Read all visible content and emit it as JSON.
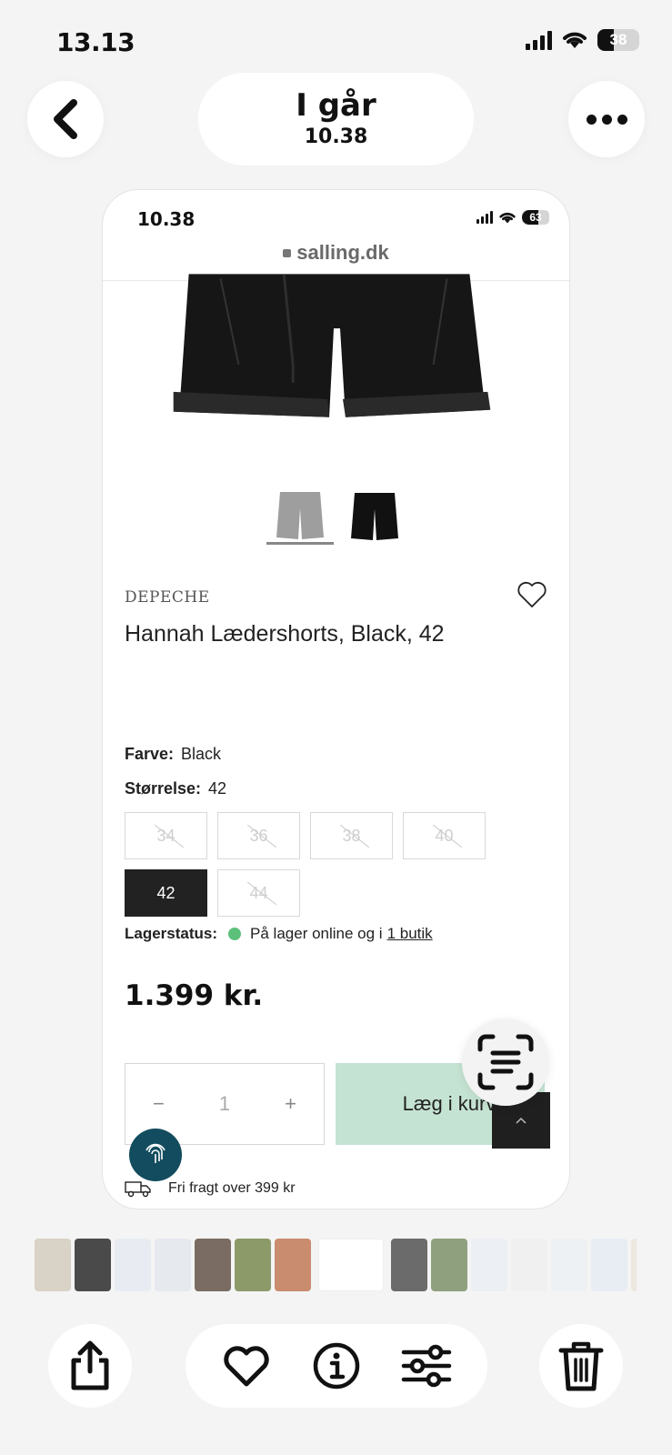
{
  "os_status": {
    "time": "13.13",
    "battery": "38"
  },
  "header": {
    "title": "I går",
    "subtitle": "10.38"
  },
  "screenshot": {
    "status": {
      "time": "10.38",
      "battery": "63"
    },
    "url": "salling.dk",
    "product": {
      "brand": "DEPECHE",
      "name": "Hannah Lædershorts, Black, 42",
      "color_label": "Farve:",
      "color_value": "Black",
      "size_label": "Størrelse:",
      "size_value": "42",
      "sizes": [
        "34",
        "36",
        "38",
        "40",
        "42",
        "44"
      ],
      "selected_size": "42",
      "stock_label": "Lagerstatus:",
      "stock_text": "På lager online og i",
      "stock_link": "1 butik",
      "price": "1.399 kr.",
      "quantity": "1",
      "add_to_cart": "Læg i kurv",
      "shipping": "Fri fragt over 399 kr"
    }
  },
  "colors": {
    "accent_green": "#c5e3d2",
    "stock_green": "#5cc07a",
    "fingerprint_teal": "#124c5e"
  }
}
